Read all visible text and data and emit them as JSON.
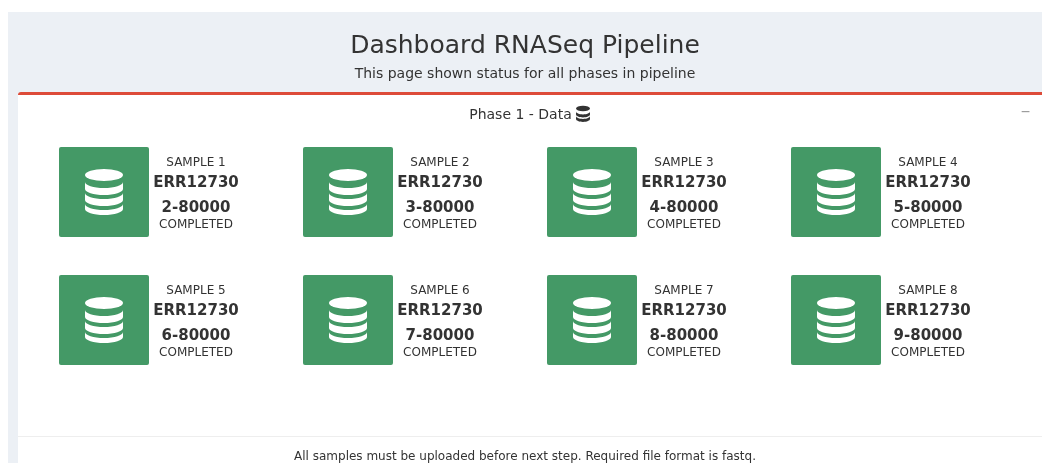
{
  "header": {
    "title": "Dashboard RNASeq Pipeline",
    "subtitle": "This page shown status for all phases in pipeline"
  },
  "phase": {
    "title": "Phase 1 - Data",
    "collapse": "−",
    "samples": [
      {
        "label": "SAMPLE 1",
        "id": "ERR127302-80000",
        "status": "COMPLETED"
      },
      {
        "label": "SAMPLE 2",
        "id": "ERR127303-80000",
        "status": "COMPLETED"
      },
      {
        "label": "SAMPLE 3",
        "id": "ERR127304-80000",
        "status": "COMPLETED"
      },
      {
        "label": "SAMPLE 4",
        "id": "ERR127305-80000",
        "status": "COMPLETED"
      },
      {
        "label": "SAMPLE 5",
        "id": "ERR127306-80000",
        "status": "COMPLETED"
      },
      {
        "label": "SAMPLE 6",
        "id": "ERR127307-80000",
        "status": "COMPLETED"
      },
      {
        "label": "SAMPLE 7",
        "id": "ERR127308-80000",
        "status": "COMPLETED"
      },
      {
        "label": "SAMPLE 8",
        "id": "ERR127309-80000",
        "status": "COMPLETED"
      }
    ],
    "footer": "All samples must be uploaded before next step. Required file format is fastq."
  }
}
